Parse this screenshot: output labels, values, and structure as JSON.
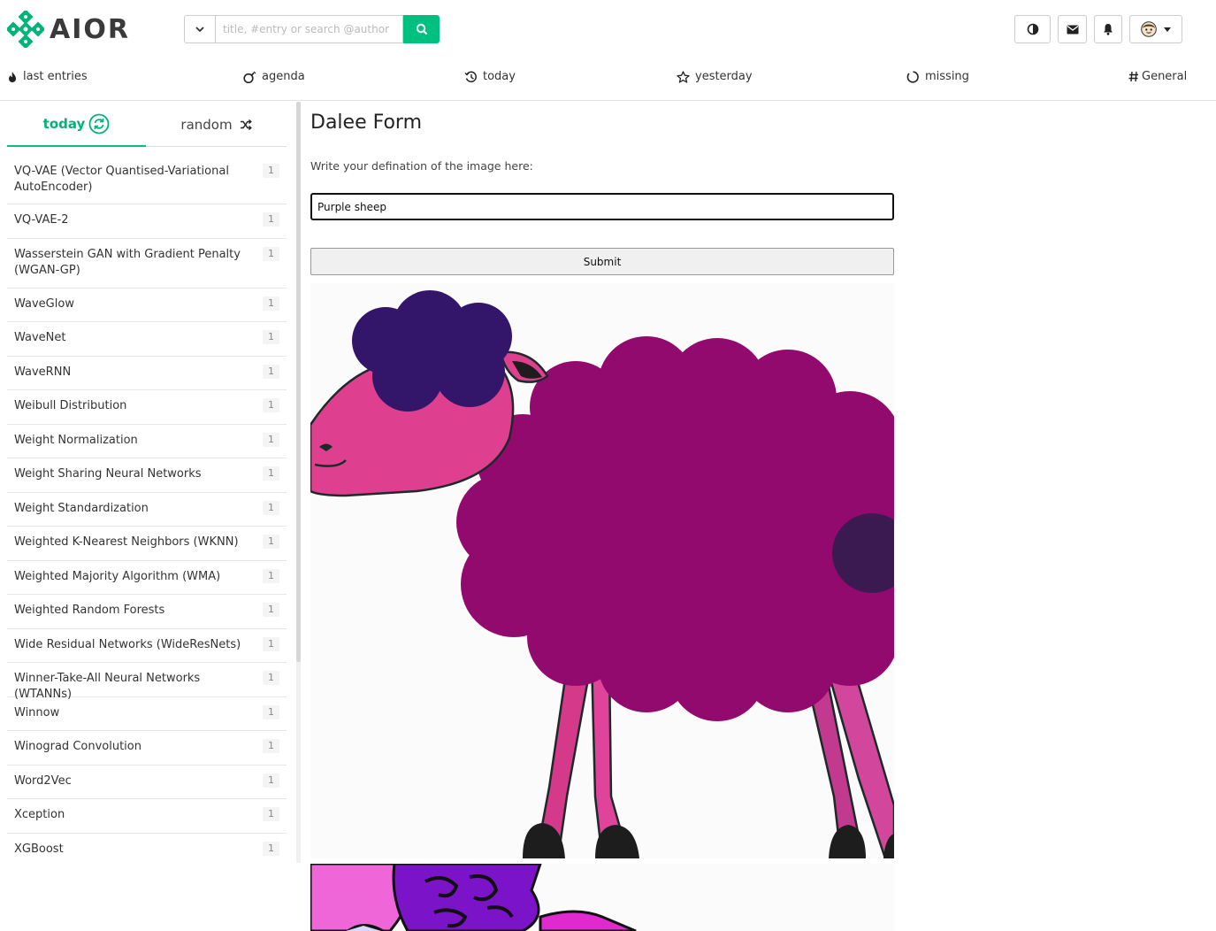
{
  "header": {
    "logo_text": "AIOR",
    "search_placeholder": "title, #entry or search @author",
    "icons": [
      "chevron-down-icon",
      "search-icon",
      "contrast-icon",
      "envelope-icon",
      "bell-icon",
      "avatar-icon"
    ]
  },
  "nav": {
    "items": [
      {
        "label": "last entries",
        "icon": "fire-icon"
      },
      {
        "label": "agenda",
        "icon": "bomb-icon"
      },
      {
        "label": "today",
        "icon": "history-icon"
      },
      {
        "label": "yesterday",
        "icon": "star-icon"
      },
      {
        "label": "missing",
        "icon": "circle-icon"
      },
      {
        "label": "General",
        "icon": "hash-icon"
      }
    ]
  },
  "sidebar": {
    "tab_today": "today",
    "tab_random": "random",
    "items": [
      {
        "label": "VQ-VAE (Vector Quantised-Variational AutoEncoder)",
        "count": "1"
      },
      {
        "label": "VQ-VAE-2",
        "count": "1"
      },
      {
        "label": "Wasserstein GAN with Gradient Penalty (WGAN-GP)",
        "count": "1"
      },
      {
        "label": "WaveGlow",
        "count": "1"
      },
      {
        "label": "WaveNet",
        "count": "1"
      },
      {
        "label": "WaveRNN",
        "count": "1"
      },
      {
        "label": "Weibull Distribution",
        "count": "1"
      },
      {
        "label": "Weight Normalization",
        "count": "1"
      },
      {
        "label": "Weight Sharing Neural Networks",
        "count": "1"
      },
      {
        "label": "Weight Standardization",
        "count": "1"
      },
      {
        "label": "Weighted K-Nearest Neighbors (WKNN)",
        "count": "1"
      },
      {
        "label": "Weighted Majority Algorithm (WMA)",
        "count": "1"
      },
      {
        "label": "Weighted Random Forests",
        "count": "1"
      },
      {
        "label": "Wide Residual Networks (WideResNets)",
        "count": "1"
      },
      {
        "label": "Winner-Take-All Neural Networks (WTANNs)",
        "count": "1"
      },
      {
        "label": "Winnow",
        "count": "1"
      },
      {
        "label": "Winograd Convolution",
        "count": "1"
      },
      {
        "label": "Word2Vec",
        "count": "1"
      },
      {
        "label": "Xception",
        "count": "1"
      },
      {
        "label": "XGBoost",
        "count": "1"
      }
    ]
  },
  "main": {
    "title": "Dalee Form",
    "label": "Write your defination of the image here:",
    "input_value": "Purple sheep",
    "submit_label": "Submit"
  },
  "colors": {
    "accent": "#00c07f",
    "sheep_body": "#930a6e",
    "sheep_face": "#de3f8e",
    "sheep_hair": "#33166a"
  }
}
